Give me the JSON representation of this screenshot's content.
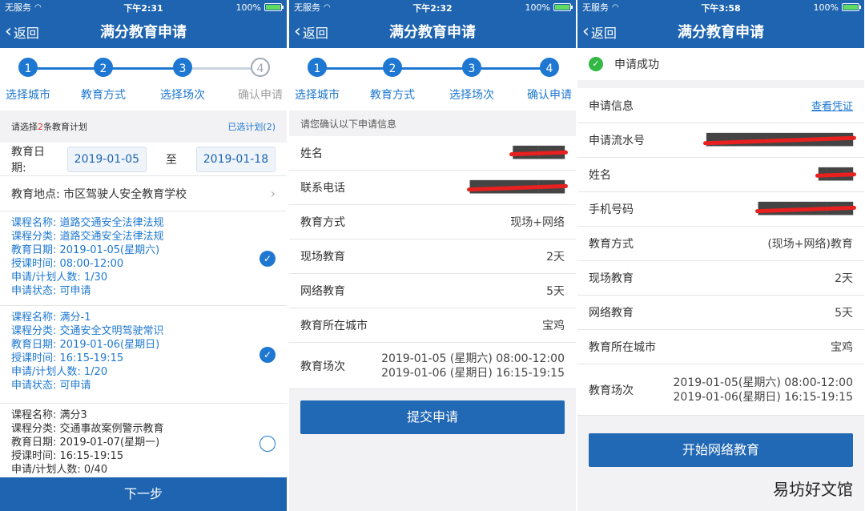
{
  "screens": [
    {
      "status": {
        "carrier": "无服务",
        "time": "下午2:31",
        "battery": "100%"
      },
      "nav": {
        "back": "返回",
        "title": "满分教育申请"
      }
    },
    {
      "status": {
        "carrier": "无服务",
        "time": "下午2:32",
        "battery": "100%"
      },
      "nav": {
        "back": "返回",
        "title": "满分教育申请"
      }
    },
    {
      "status": {
        "carrier": "无服务",
        "time": "下午3:58",
        "battery": "100%"
      },
      "nav": {
        "back": "返回",
        "title": "满分教育申请"
      }
    }
  ],
  "steps": [
    {
      "num": "1",
      "label": "选择城市"
    },
    {
      "num": "2",
      "label": "教育方式"
    },
    {
      "num": "3",
      "label": "选择场次"
    },
    {
      "num": "4",
      "label": "确认申请"
    }
  ],
  "s1": {
    "select_prefix": "请选择",
    "select_count": "2",
    "select_suffix": "条教育计划",
    "selected_link": "已选计划(2)",
    "date_label": "教育日期:",
    "date_from": "2019-01-05",
    "date_to_label": "至",
    "date_to": "2019-01-18",
    "place_label": "教育地点:",
    "place_value": "市区驾驶人安全教育学校",
    "courses": [
      {
        "name": "课程名称: 道路交通安全法律法规",
        "category": "课程分类: 道路交通安全法律法规",
        "date": "教育日期: 2019-01-05(星期六)",
        "time": "授课时间: 08:00-12:00",
        "count": "申请/计划人数: 1/30",
        "state": "申请状态: 可申请"
      },
      {
        "name": "课程名称: 满分-1",
        "category": "课程分类: 交通安全文明驾驶常识",
        "date": "教育日期: 2019-01-06(星期日)",
        "time": "授课时间: 16:15-19:15",
        "count": "申请/计划人数: 1/20",
        "state": "申请状态: 可申请"
      },
      {
        "name": "课程名称: 满分3",
        "category": "课程分类: 交通事故案例警示教育",
        "date": "教育日期: 2019-01-07(星期一)",
        "time": "授课时间: 16:15-19:15",
        "count": "申请/计划人数: 0/40"
      }
    ],
    "next_button": "下一步"
  },
  "s2": {
    "hint": "请您确认以下申请信息",
    "rows": [
      {
        "k": "姓名",
        "v": "██████"
      },
      {
        "k": "联系电话",
        "v": "███████████"
      },
      {
        "k": "教育方式",
        "v": "现场+网络"
      },
      {
        "k": "现场教育",
        "v": "2天"
      },
      {
        "k": "网络教育",
        "v": "5天"
      },
      {
        "k": "教育所在城市",
        "v": "宝鸡"
      }
    ],
    "session_label": "教育场次",
    "session_lines": [
      "2019-01-05 (星期六) 08:00-12:00",
      "2019-01-06 (星期日) 16:15-19:15"
    ],
    "submit_button": "提交申请"
  },
  "s3": {
    "success_text": "申请成功",
    "info_label": "申请信息",
    "voucher_link": "查看凭证",
    "rows": [
      {
        "k": "申请流水号",
        "v": "█████████████████"
      },
      {
        "k": "姓名",
        "v": "████"
      },
      {
        "k": "手机号码",
        "v": "███████████"
      },
      {
        "k": "教育方式",
        "v": "(现场+网络)教育"
      },
      {
        "k": "现场教育",
        "v": "2天"
      },
      {
        "k": "网络教育",
        "v": "5天"
      },
      {
        "k": "教育所在城市",
        "v": "宝鸡"
      }
    ],
    "session_label": "教育场次",
    "session_lines": [
      "2019-01-05(星期六) 08:00-12:00",
      "2019-01-06(星期日) 16:15-19:15"
    ],
    "start_button": "开始网络教育"
  },
  "watermark": "易坊好文馆",
  "colors": {
    "brand": "#1e64b0",
    "accent": "#1e78d2",
    "success": "#33b844",
    "redact": "#e82020"
  },
  "icons": [
    "back-chevron-icon",
    "wifi-icon",
    "battery-icon",
    "check-circle-icon",
    "success-check-icon",
    "chevron-right-icon"
  ]
}
